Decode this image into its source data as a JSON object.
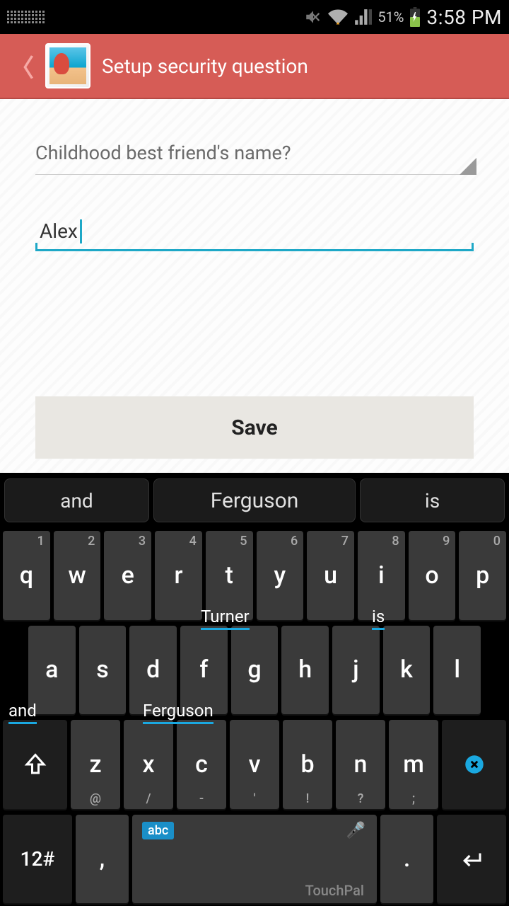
{
  "status": {
    "battery_pct": "51%",
    "time": "3:58 PM"
  },
  "header": {
    "title": "Setup security question"
  },
  "question": {
    "selected": "Childhood best friend's name?"
  },
  "answer": {
    "value": "Alex"
  },
  "buttons": {
    "save": "Save"
  },
  "keyboard": {
    "suggestions": [
      "and",
      "Ferguson",
      "is"
    ],
    "row1": [
      {
        "k": "q",
        "n": "1"
      },
      {
        "k": "w",
        "n": "2"
      },
      {
        "k": "e",
        "n": "3"
      },
      {
        "k": "r",
        "n": "4"
      },
      {
        "k": "t",
        "n": "5"
      },
      {
        "k": "y",
        "n": "6"
      },
      {
        "k": "u",
        "n": "7"
      },
      {
        "k": "i",
        "n": "8"
      },
      {
        "k": "o",
        "n": "9"
      },
      {
        "k": "p",
        "n": "0"
      }
    ],
    "row2": [
      {
        "k": "a"
      },
      {
        "k": "s"
      },
      {
        "k": "d"
      },
      {
        "k": "f"
      },
      {
        "k": "g"
      },
      {
        "k": "h"
      },
      {
        "k": "j"
      },
      {
        "k": "k"
      },
      {
        "k": "l"
      }
    ],
    "row3": [
      {
        "k": "z",
        "s": "@"
      },
      {
        "k": "x",
        "s": "/"
      },
      {
        "k": "c",
        "s": "-"
      },
      {
        "k": "v",
        "s": "'"
      },
      {
        "k": "b",
        "s": "!"
      },
      {
        "k": "n",
        "s": "?"
      },
      {
        "k": "m",
        "s": ";"
      }
    ],
    "row4": {
      "numlock": "12#",
      "comma": ",",
      "abc": "abc",
      "brand": "TouchPal",
      "period": "."
    },
    "flow_hints": {
      "turner": "Turner",
      "is": "is",
      "and": "and",
      "ferguson": "Ferguson"
    }
  }
}
